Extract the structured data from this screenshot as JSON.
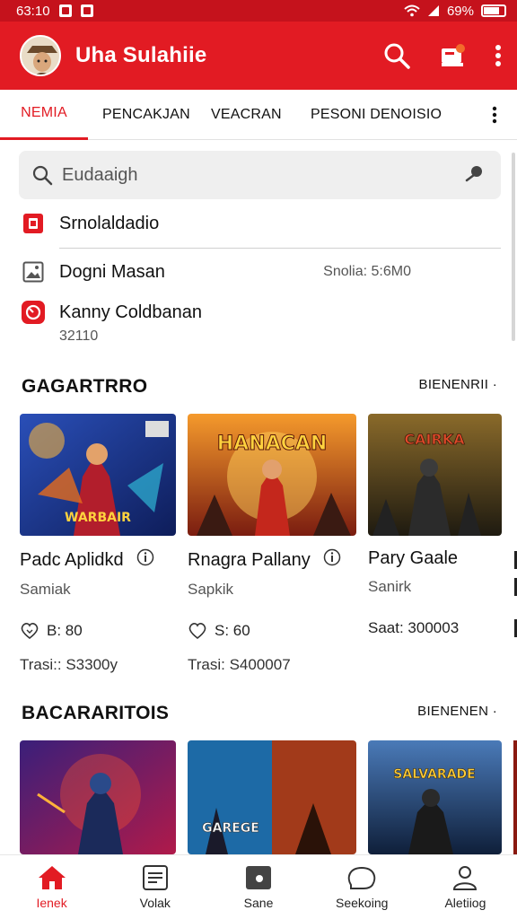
{
  "status_bar": {
    "time": "63:10",
    "battery": "69%"
  },
  "app_bar": {
    "title": "Uha Sulahiie"
  },
  "tabs": [
    {
      "label": "NEMIA"
    },
    {
      "label": "PENCAKJAN"
    },
    {
      "label": "VEACRAN"
    },
    {
      "label": "PESONI DENOISIO"
    }
  ],
  "search": {
    "placeholder": "Eudaaigh"
  },
  "quick_items": [
    {
      "label": "Srnolaldadio"
    },
    {
      "label": "Dogni Masan",
      "right": "Snolia: 5:6M0"
    },
    {
      "label": "Kanny Coldbanan",
      "sub": "32110"
    }
  ],
  "sections": [
    {
      "title": "GAGARTRRO",
      "link": "BIENENRII",
      "cards": [
        {
          "title": "Padc Aplidkd",
          "sub": "Samiak",
          "stat": "B: 80",
          "footer": "Trasi:: S3300y",
          "art": "WARBAIR"
        },
        {
          "title": "Rnagra Pallany",
          "sub": "Sapkik",
          "stat": "S: 60",
          "footer": "Trasi: S400007",
          "art": "HANACAN"
        },
        {
          "title": "Pary Gaale",
          "sub": "Sanirk",
          "stat": "Saat: 300003",
          "footer": "",
          "art": "CAIRKA"
        }
      ]
    },
    {
      "title": "BACARARITOIS",
      "link": "BIENENEN",
      "cards": [
        {
          "art": ""
        },
        {
          "art": "GAREGE"
        },
        {
          "art": "SALVARADE"
        }
      ]
    }
  ],
  "bottom_nav": [
    {
      "label": "Ienek",
      "icon": "home-icon"
    },
    {
      "label": "Volak",
      "icon": "list-icon"
    },
    {
      "label": "Sane",
      "icon": "media-icon"
    },
    {
      "label": "Seekoing",
      "icon": "heart-icon"
    },
    {
      "label": "Aletiiog",
      "icon": "person-icon"
    }
  ],
  "colors": {
    "accent": "#e21b23",
    "accent_dark": "#c5121c"
  }
}
